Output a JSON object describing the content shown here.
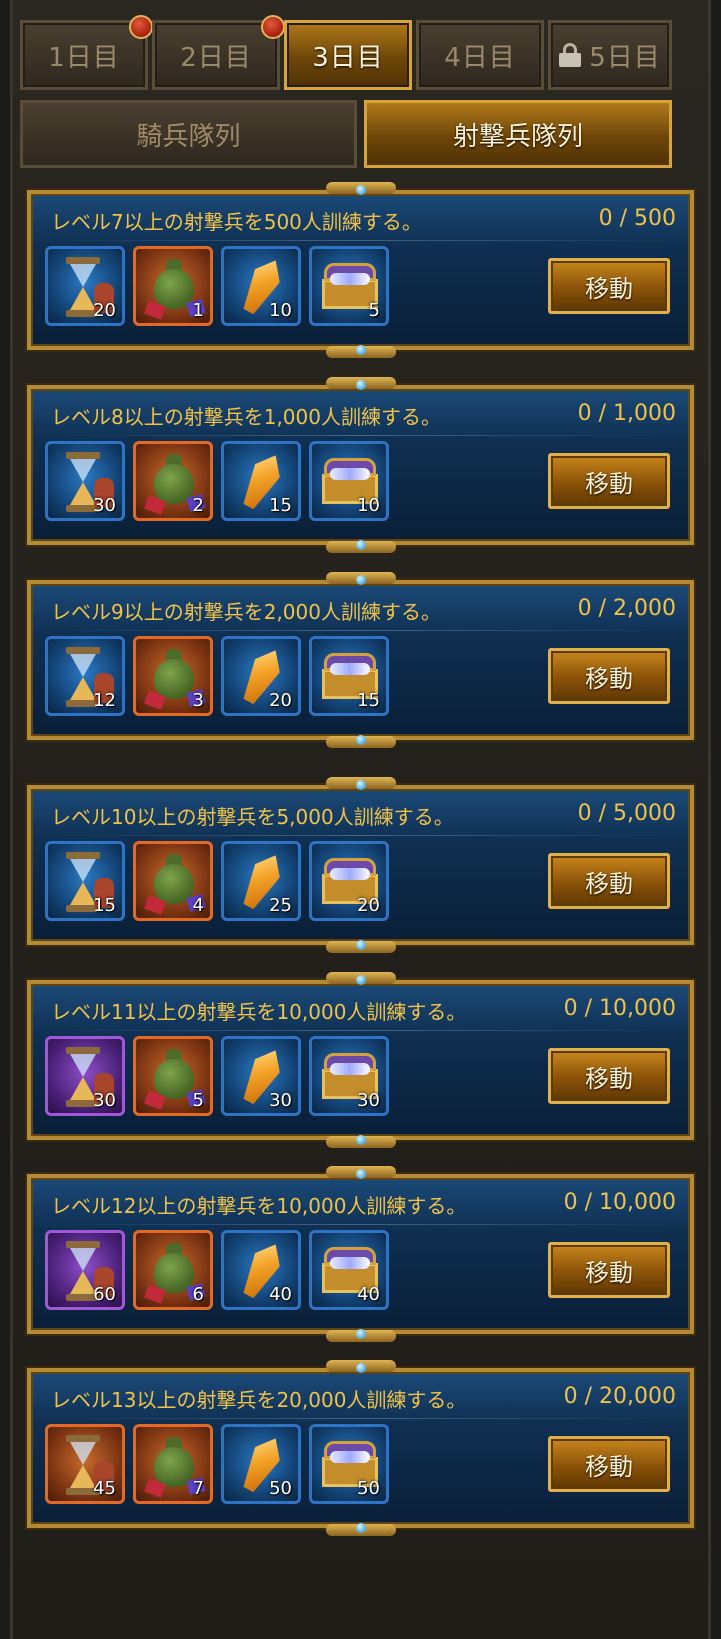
{
  "day_tabs": [
    {
      "label": "1日目",
      "badge": true
    },
    {
      "label": "2日目",
      "badge": true
    },
    {
      "label": "3日目",
      "active": true
    },
    {
      "label": "4日目"
    },
    {
      "label": "5日目",
      "locked": true
    }
  ],
  "formation_tabs": [
    {
      "label": "騎兵隊列"
    },
    {
      "label": "射撃兵隊列",
      "active": true
    }
  ],
  "move_label": "移動",
  "quests": [
    {
      "desc": "レベル7以上の射撃兵を500人訓練する。",
      "progress": "0 / 500",
      "rewards": [
        {
          "icon": "hourglass-icon",
          "qty": "20",
          "rarity": "blue"
        },
        {
          "icon": "bag-icon",
          "qty": "1",
          "rarity": "orange"
        },
        {
          "icon": "crystal-icon",
          "qty": "10",
          "rarity": "blue"
        },
        {
          "icon": "chest-icon",
          "qty": "5",
          "rarity": "blue"
        }
      ]
    },
    {
      "desc": "レベル8以上の射撃兵を1,000人訓練する。",
      "progress": "0 / 1,000",
      "rewards": [
        {
          "icon": "hourglass-icon",
          "qty": "30",
          "rarity": "blue"
        },
        {
          "icon": "bag-icon",
          "qty": "2",
          "rarity": "orange"
        },
        {
          "icon": "crystal-icon",
          "qty": "15",
          "rarity": "blue"
        },
        {
          "icon": "chest-icon",
          "qty": "10",
          "rarity": "blue"
        }
      ]
    },
    {
      "desc": "レベル9以上の射撃兵を2,000人訓練する。",
      "progress": "0 / 2,000",
      "rewards": [
        {
          "icon": "hourglass-icon",
          "qty": "12",
          "rarity": "blue"
        },
        {
          "icon": "bag-icon",
          "qty": "3",
          "rarity": "orange"
        },
        {
          "icon": "crystal-icon",
          "qty": "20",
          "rarity": "blue"
        },
        {
          "icon": "chest-icon",
          "qty": "15",
          "rarity": "blue"
        }
      ]
    },
    {
      "desc": "レベル10以上の射撃兵を5,000人訓練する。",
      "progress": "0 / 5,000",
      "rewards": [
        {
          "icon": "hourglass-icon",
          "qty": "15",
          "rarity": "blue"
        },
        {
          "icon": "bag-icon",
          "qty": "4",
          "rarity": "orange"
        },
        {
          "icon": "crystal-icon",
          "qty": "25",
          "rarity": "blue"
        },
        {
          "icon": "chest-icon",
          "qty": "20",
          "rarity": "blue"
        }
      ]
    },
    {
      "desc": "レベル11以上の射撃兵を10,000人訓練する。",
      "progress": "0 / 10,000",
      "rewards": [
        {
          "icon": "hourglass-icon",
          "qty": "30",
          "rarity": "purple"
        },
        {
          "icon": "bag-icon",
          "qty": "5",
          "rarity": "orange"
        },
        {
          "icon": "crystal-icon",
          "qty": "30",
          "rarity": "blue"
        },
        {
          "icon": "chest-icon",
          "qty": "30",
          "rarity": "blue"
        }
      ]
    },
    {
      "desc": "レベル12以上の射撃兵を10,000人訓練する。",
      "progress": "0 / 10,000",
      "rewards": [
        {
          "icon": "hourglass-icon",
          "qty": "60",
          "rarity": "purple"
        },
        {
          "icon": "bag-icon",
          "qty": "6",
          "rarity": "orange"
        },
        {
          "icon": "crystal-icon",
          "qty": "40",
          "rarity": "blue"
        },
        {
          "icon": "chest-icon",
          "qty": "40",
          "rarity": "blue"
        }
      ]
    },
    {
      "desc": "レベル13以上の射撃兵を20,000人訓練する。",
      "progress": "0 / 20,000",
      "rewards": [
        {
          "icon": "hourglass-icon",
          "qty": "45",
          "rarity": "orange"
        },
        {
          "icon": "bag-icon",
          "qty": "7",
          "rarity": "orange"
        },
        {
          "icon": "crystal-icon",
          "qty": "50",
          "rarity": "blue"
        },
        {
          "icon": "chest-icon",
          "qty": "50",
          "rarity": "blue"
        }
      ]
    }
  ]
}
